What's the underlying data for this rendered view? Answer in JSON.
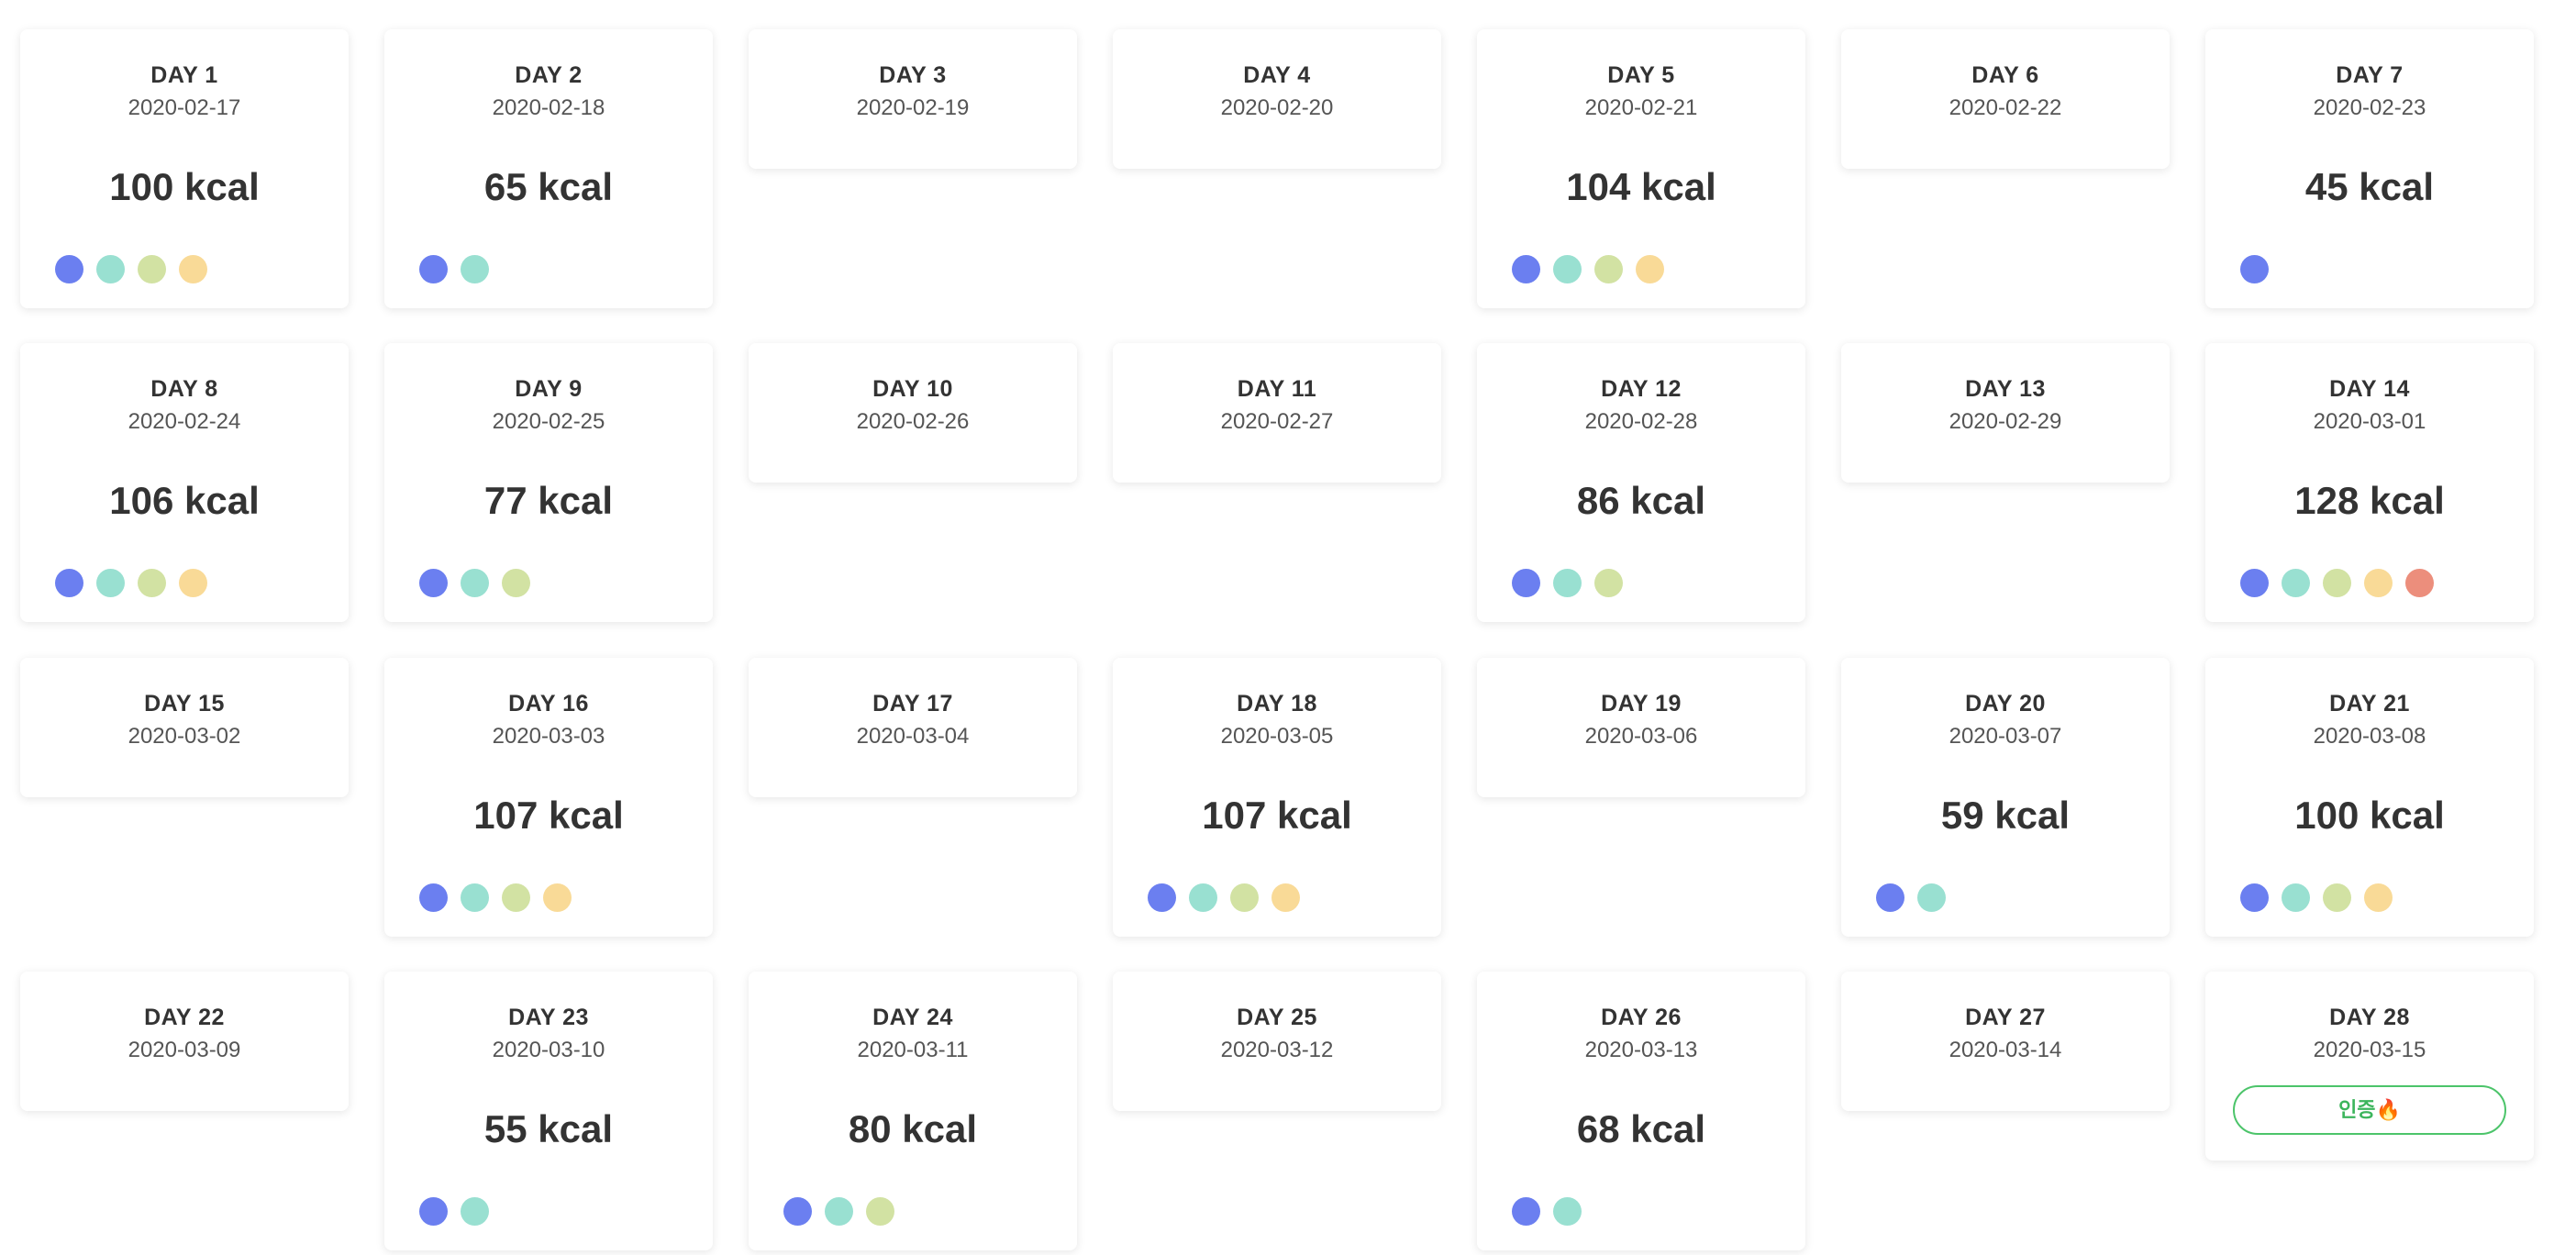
{
  "kcal_unit": "kcal",
  "dot_colors": {
    "blue": "#6b7ff0",
    "teal": "#99e0d1",
    "olive": "#d2e2a3",
    "yellow": "#f9da97",
    "red": "#ec8e7c"
  },
  "days": [
    {
      "label": "DAY 1",
      "date": "2020-02-17",
      "kcal": "100 kcal",
      "dots": [
        "blue",
        "teal",
        "olive",
        "yellow"
      ]
    },
    {
      "label": "DAY 2",
      "date": "2020-02-18",
      "kcal": "65 kcal",
      "dots": [
        "blue",
        "teal"
      ]
    },
    {
      "label": "DAY 3",
      "date": "2020-02-19",
      "kcal": null,
      "dots": []
    },
    {
      "label": "DAY 4",
      "date": "2020-02-20",
      "kcal": null,
      "dots": []
    },
    {
      "label": "DAY 5",
      "date": "2020-02-21",
      "kcal": "104 kcal",
      "dots": [
        "blue",
        "teal",
        "olive",
        "yellow"
      ]
    },
    {
      "label": "DAY 6",
      "date": "2020-02-22",
      "kcal": null,
      "dots": []
    },
    {
      "label": "DAY 7",
      "date": "2020-02-23",
      "kcal": "45 kcal",
      "dots": [
        "blue"
      ]
    },
    {
      "label": "DAY 8",
      "date": "2020-02-24",
      "kcal": "106 kcal",
      "dots": [
        "blue",
        "teal",
        "olive",
        "yellow"
      ]
    },
    {
      "label": "DAY 9",
      "date": "2020-02-25",
      "kcal": "77 kcal",
      "dots": [
        "blue",
        "teal",
        "olive"
      ]
    },
    {
      "label": "DAY 10",
      "date": "2020-02-26",
      "kcal": null,
      "dots": []
    },
    {
      "label": "DAY 11",
      "date": "2020-02-27",
      "kcal": null,
      "dots": []
    },
    {
      "label": "DAY 12",
      "date": "2020-02-28",
      "kcal": "86 kcal",
      "dots": [
        "blue",
        "teal",
        "olive"
      ]
    },
    {
      "label": "DAY 13",
      "date": "2020-02-29",
      "kcal": null,
      "dots": []
    },
    {
      "label": "DAY 14",
      "date": "2020-03-01",
      "kcal": "128 kcal",
      "dots": [
        "blue",
        "teal",
        "olive",
        "yellow",
        "red"
      ]
    },
    {
      "label": "DAY 15",
      "date": "2020-03-02",
      "kcal": null,
      "dots": []
    },
    {
      "label": "DAY 16",
      "date": "2020-03-03",
      "kcal": "107 kcal",
      "dots": [
        "blue",
        "teal",
        "olive",
        "yellow"
      ]
    },
    {
      "label": "DAY 17",
      "date": "2020-03-04",
      "kcal": null,
      "dots": []
    },
    {
      "label": "DAY 18",
      "date": "2020-03-05",
      "kcal": "107 kcal",
      "dots": [
        "blue",
        "teal",
        "olive",
        "yellow"
      ]
    },
    {
      "label": "DAY 19",
      "date": "2020-03-06",
      "kcal": null,
      "dots": []
    },
    {
      "label": "DAY 20",
      "date": "2020-03-07",
      "kcal": "59 kcal",
      "dots": [
        "blue",
        "teal"
      ]
    },
    {
      "label": "DAY 21",
      "date": "2020-03-08",
      "kcal": "100 kcal",
      "dots": [
        "blue",
        "teal",
        "olive",
        "yellow"
      ]
    },
    {
      "label": "DAY 22",
      "date": "2020-03-09",
      "kcal": null,
      "dots": []
    },
    {
      "label": "DAY 23",
      "date": "2020-03-10",
      "kcal": "55 kcal",
      "dots": [
        "blue",
        "teal"
      ]
    },
    {
      "label": "DAY 24",
      "date": "2020-03-11",
      "kcal": "80 kcal",
      "dots": [
        "blue",
        "teal",
        "olive"
      ]
    },
    {
      "label": "DAY 25",
      "date": "2020-03-12",
      "kcal": null,
      "dots": []
    },
    {
      "label": "DAY 26",
      "date": "2020-03-13",
      "kcal": "68 kcal",
      "dots": [
        "blue",
        "teal"
      ]
    },
    {
      "label": "DAY 27",
      "date": "2020-03-14",
      "kcal": null,
      "dots": []
    },
    {
      "label": "DAY 28",
      "date": "2020-03-15",
      "kcal": null,
      "dots": [],
      "button": "인증🔥"
    }
  ]
}
